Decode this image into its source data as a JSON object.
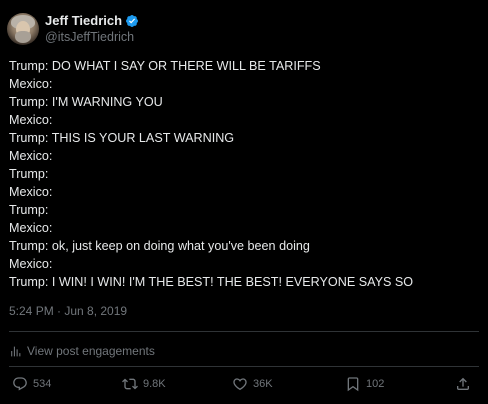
{
  "author": {
    "display_name": "Jeff Tiedrich",
    "handle": "@itsJeffTiedrich",
    "verified_badge_icon": "verified-check-icon",
    "verified_color": "#1d9bf0"
  },
  "post": {
    "lines": [
      "Trump: DO WHAT I SAY OR THERE WILL BE TARIFFS",
      "Mexico:",
      "Trump: I'M WARNING YOU",
      "Mexico:",
      "Trump: THIS IS YOUR LAST WARNING",
      "Mexico:",
      "Trump:",
      "Mexico:",
      "Trump:",
      "Mexico:",
      "Trump: ok, just keep on doing what you've been doing",
      "Mexico:",
      "Trump: I WIN! I WIN! I'M THE BEST! THE BEST! EVERYONE SAYS SO"
    ],
    "timestamp": "5:24 PM · Jun 8, 2019"
  },
  "engagements": {
    "label": "View post engagements",
    "icon": "bar-chart-icon"
  },
  "actions": {
    "reply": {
      "count": "534",
      "icon": "reply-icon"
    },
    "repost": {
      "count": "9.8K",
      "icon": "repost-icon"
    },
    "like": {
      "count": "36K",
      "icon": "heart-icon"
    },
    "bookmark": {
      "count": "102",
      "icon": "bookmark-icon"
    },
    "share": {
      "icon": "share-icon"
    }
  },
  "colors": {
    "background": "#000000",
    "text": "#e7e9ea",
    "secondary": "#71767b",
    "divider": "#2f3336"
  }
}
